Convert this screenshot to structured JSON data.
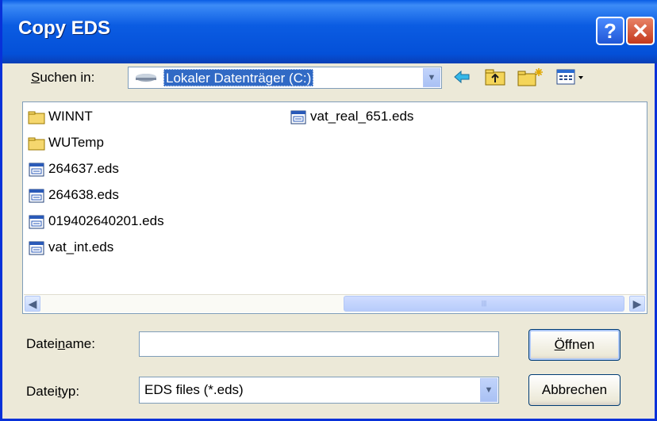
{
  "window": {
    "title": "Copy EDS",
    "help_glyph": "?",
    "close_glyph": "✕"
  },
  "lookin": {
    "label_pre": "",
    "label_u": "S",
    "label_post": "uchen in:",
    "value": "Lokaler Datenträger (C:)"
  },
  "files": {
    "col1": [
      {
        "name": "WINNT",
        "type": "folder"
      },
      {
        "name": "WUTemp",
        "type": "folder"
      },
      {
        "name": "264637.eds",
        "type": "eds"
      },
      {
        "name": "264638.eds",
        "type": "eds"
      },
      {
        "name": "019402640201.eds",
        "type": "eds"
      },
      {
        "name": "vat_int.eds",
        "type": "eds"
      }
    ],
    "col2": [
      {
        "name": "vat_real_651.eds",
        "type": "eds"
      }
    ]
  },
  "filename": {
    "label_pre": "Datei",
    "label_u": "n",
    "label_post": "ame:",
    "value": ""
  },
  "filetype": {
    "label_pre": "Datei",
    "label_u": "t",
    "label_post": "yp:",
    "value": "EDS files (*.eds)"
  },
  "buttons": {
    "open_u": "Ö",
    "open_rest": "ffnen",
    "cancel": "Abbrechen"
  },
  "colors": {
    "titlebar": "#0b5ce2",
    "selection": "#316ac5",
    "window_bg": "#ece9d8"
  }
}
